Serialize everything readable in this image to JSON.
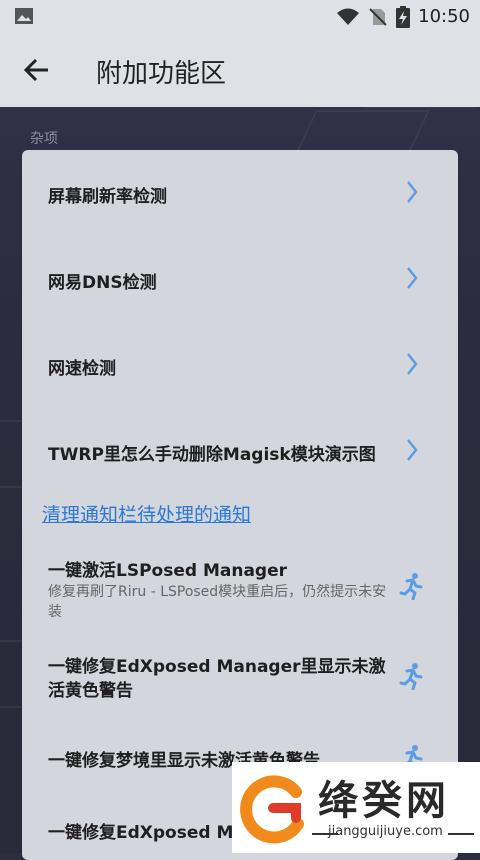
{
  "status_bar": {
    "time": "10:50",
    "icons": [
      "image-icon",
      "wifi-icon",
      "no-sim-icon",
      "battery-charging-icon"
    ]
  },
  "app_bar": {
    "title": "附加功能区",
    "back_icon": "arrow-left-icon"
  },
  "section": {
    "label": "杂项"
  },
  "items": [
    {
      "label": "屏幕刷新率检测",
      "icon": "chevron-right-icon"
    },
    {
      "label": "网易DNS检测",
      "icon": "chevron-right-icon"
    },
    {
      "label": "网速检测",
      "icon": "chevron-right-icon"
    },
    {
      "label": "TWRP里怎么手动删除Magisk模块演示图",
      "icon": "chevron-right-icon"
    }
  ],
  "notice_link": "清理通知栏待处理的通知",
  "actions": [
    {
      "label": "一键激活LSPosed Manager",
      "description": "修复再刷了Riru - LSPosed模块重启后，仍然提示未安装",
      "icon": "running-man-icon"
    },
    {
      "label_line1": "一键修复EdXposed Manager里显示未激",
      "label_line2": "活黄色警告",
      "icon": "running-man-icon"
    },
    {
      "label": "一键修复梦境里显示未激活黄色警告",
      "icon": "running-man-icon"
    },
    {
      "label": "一键修复EdXposed M",
      "icon": "running-man-icon"
    }
  ],
  "watermark": {
    "name": "绛癸网",
    "url": "jiangguijiuye.com"
  },
  "colors": {
    "accent": "#2b78d6",
    "card": "#d3d6dc",
    "background": "#2e2e3f"
  }
}
